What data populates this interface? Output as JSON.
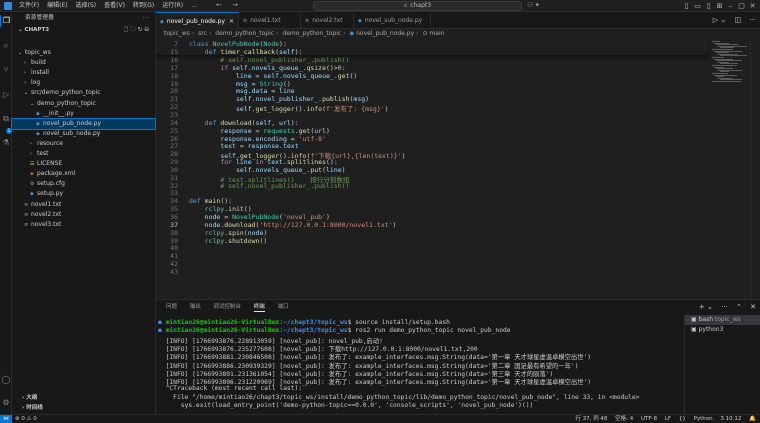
{
  "titlebar": {
    "menus": [
      "文件(F)",
      "编辑(E)",
      "选择(S)",
      "查看(V)",
      "转到(G)",
      "运行(R)",
      "…"
    ],
    "search_text": "chapt3",
    "back_glyph": "←",
    "forward_glyph": "→"
  },
  "activity_bar": {
    "icons": [
      "explorer-icon",
      "search-icon",
      "source-control-icon",
      "run-debug-icon",
      "remote-explorer-icon",
      "testing-icon",
      "accounts-icon",
      "manage-icon"
    ],
    "badge": "1"
  },
  "sidebar": {
    "header": "资源管理器",
    "project": "CHAPT3",
    "tree": [
      {
        "label": "topic_ws",
        "indent": 0,
        "kind": "folder-open"
      },
      {
        "label": "build",
        "indent": 1,
        "kind": "folder"
      },
      {
        "label": "install",
        "indent": 1,
        "kind": "folder"
      },
      {
        "label": "log",
        "indent": 1,
        "kind": "folder"
      },
      {
        "label": "src/demo_python_topic",
        "indent": 1,
        "kind": "folder-open"
      },
      {
        "label": "demo_python_topic",
        "indent": 2,
        "kind": "folder-open"
      },
      {
        "label": "__init__.py",
        "indent": 3,
        "kind": "py"
      },
      {
        "label": "novel_pub_node.py",
        "indent": 3,
        "kind": "py",
        "selected": true
      },
      {
        "label": "novel_sub_node.py",
        "indent": 3,
        "kind": "py"
      },
      {
        "label": "resource",
        "indent": 2,
        "kind": "folder"
      },
      {
        "label": "test",
        "indent": 2,
        "kind": "folder"
      },
      {
        "label": "LICENSE",
        "indent": 2,
        "kind": "lic"
      },
      {
        "label": "package.xml",
        "indent": 2,
        "kind": "xml"
      },
      {
        "label": "setup.cfg",
        "indent": 2,
        "kind": "cfg"
      },
      {
        "label": "setup.py",
        "indent": 2,
        "kind": "py"
      },
      {
        "label": "novel1.txt",
        "indent": 1,
        "kind": "txt"
      },
      {
        "label": "novel2.txt",
        "indent": 1,
        "kind": "txt"
      },
      {
        "label": "novel3.txt",
        "indent": 1,
        "kind": "txt"
      }
    ],
    "outline_label": "大纲",
    "timeline_label": "时间线"
  },
  "tabs": [
    {
      "label": "novel_pub_node.py",
      "icon": "py",
      "active": true
    },
    {
      "label": "novel1.txt",
      "icon": "txt",
      "active": false
    },
    {
      "label": "novel2.txt",
      "icon": "txt",
      "active": false
    },
    {
      "label": "novel_sub_node.py",
      "icon": "py",
      "active": false
    }
  ],
  "breadcrumb": [
    "topic_ws",
    "src",
    "demo_python_topic",
    "demo_python_topic",
    "novel_pub_node.py",
    "main"
  ],
  "editor": {
    "current_line": 37,
    "sticky": [
      {
        "num": 7,
        "tokens": [
          [
            "kw",
            "class "
          ],
          [
            "cls",
            "NovelPubNode"
          ],
          [
            "",
            "("
          ],
          [
            "cls",
            "Node"
          ],
          [
            "",
            "):"
          ]
        ]
      },
      {
        "num": 15,
        "tokens": [
          [
            "",
            "    "
          ],
          [
            "kw",
            "def "
          ],
          [
            "fn",
            "timer_callback"
          ],
          [
            "",
            "("
          ],
          [
            "slf",
            "self"
          ],
          [
            "",
            "):"
          ]
        ]
      }
    ],
    "lines": [
      {
        "num": 16,
        "tokens": [
          [
            "cm",
            "        # self.novel_publisher_.publish()"
          ]
        ]
      },
      {
        "num": 17,
        "tokens": [
          [
            "",
            "        "
          ],
          [
            "kw2",
            "if "
          ],
          [
            "slf",
            "self"
          ],
          [
            "",
            "."
          ],
          [
            "var",
            "novels_queue_"
          ],
          [
            "",
            "."
          ],
          [
            "fn",
            "qsize"
          ],
          [
            "",
            "()>"
          ],
          [
            "num",
            "0"
          ],
          [
            "",
            ":"
          ]
        ]
      },
      {
        "num": 18,
        "tokens": [
          [
            "",
            "            "
          ],
          [
            "var",
            "line"
          ],
          [
            "",
            " = "
          ],
          [
            "slf",
            "self"
          ],
          [
            "",
            "."
          ],
          [
            "var",
            "novels_queue_"
          ],
          [
            "",
            "."
          ],
          [
            "fn",
            "get"
          ],
          [
            "",
            "()"
          ]
        ]
      },
      {
        "num": 19,
        "tokens": [
          [
            "",
            "            "
          ],
          [
            "var",
            "msg"
          ],
          [
            "",
            " = "
          ],
          [
            "cls",
            "String"
          ],
          [
            "",
            "()"
          ]
        ]
      },
      {
        "num": 20,
        "tokens": [
          [
            "",
            "            "
          ],
          [
            "var",
            "msg"
          ],
          [
            "",
            "."
          ],
          [
            "var",
            "data"
          ],
          [
            "",
            " = "
          ],
          [
            "var",
            "line"
          ]
        ]
      },
      {
        "num": 21,
        "tokens": [
          [
            "",
            "            "
          ],
          [
            "slf",
            "self"
          ],
          [
            "",
            "."
          ],
          [
            "var",
            "novel_publisher_"
          ],
          [
            "",
            "."
          ],
          [
            "fn",
            "publish"
          ],
          [
            "",
            "("
          ],
          [
            "var",
            "msg"
          ],
          [
            "",
            ")"
          ]
        ]
      },
      {
        "num": 22,
        "tokens": [
          [
            "",
            "            "
          ],
          [
            "slf",
            "self"
          ],
          [
            "",
            "."
          ],
          [
            "fn",
            "get_logger"
          ],
          [
            "",
            "()."
          ],
          [
            "fn",
            "info"
          ],
          [
            "",
            "("
          ],
          [
            "str",
            "f'发布了: {msg}'"
          ],
          [
            "",
            ")"
          ]
        ]
      },
      {
        "num": 23,
        "tokens": []
      },
      {
        "num": 24,
        "tokens": [
          [
            "",
            "    "
          ],
          [
            "kw",
            "def "
          ],
          [
            "fn",
            "download"
          ],
          [
            "",
            "("
          ],
          [
            "slf",
            "self"
          ],
          [
            "",
            ", "
          ],
          [
            "var",
            "url"
          ],
          [
            "",
            "):"
          ]
        ]
      },
      {
        "num": 25,
        "tokens": [
          [
            "",
            "        "
          ],
          [
            "var",
            "response"
          ],
          [
            "",
            " = "
          ],
          [
            "cls",
            "requests"
          ],
          [
            "",
            "."
          ],
          [
            "fn",
            "get"
          ],
          [
            "",
            "("
          ],
          [
            "var",
            "url"
          ],
          [
            "",
            ")"
          ]
        ]
      },
      {
        "num": 26,
        "tokens": [
          [
            "",
            "        "
          ],
          [
            "var",
            "response"
          ],
          [
            "",
            "."
          ],
          [
            "var",
            "encoding"
          ],
          [
            "",
            " = "
          ],
          [
            "str",
            "'utf-8'"
          ]
        ]
      },
      {
        "num": 27,
        "tokens": [
          [
            "",
            "        "
          ],
          [
            "var",
            "text"
          ],
          [
            "",
            " = "
          ],
          [
            "var",
            "response"
          ],
          [
            "",
            "."
          ],
          [
            "var",
            "text"
          ]
        ]
      },
      {
        "num": 28,
        "tokens": [
          [
            "",
            "        "
          ],
          [
            "slf",
            "self"
          ],
          [
            "",
            "."
          ],
          [
            "fn",
            "get_logger"
          ],
          [
            "",
            "()."
          ],
          [
            "fn",
            "info"
          ],
          [
            "",
            "("
          ],
          [
            "str",
            "f'下载{url},{len(text)}'"
          ],
          [
            "",
            ")"
          ]
        ]
      },
      {
        "num": 29,
        "tokens": [
          [
            "",
            "        "
          ],
          [
            "kw2",
            "for "
          ],
          [
            "var",
            "line"
          ],
          [
            "kw2",
            " in "
          ],
          [
            "var",
            "text"
          ],
          [
            "",
            "."
          ],
          [
            "fn",
            "splitlines"
          ],
          [
            "",
            "():"
          ]
        ]
      },
      {
        "num": 30,
        "tokens": [
          [
            "",
            "            "
          ],
          [
            "slf",
            "self"
          ],
          [
            "",
            "."
          ],
          [
            "var",
            "novels_queue_"
          ],
          [
            "",
            "."
          ],
          [
            "fn",
            "put"
          ],
          [
            "",
            "("
          ],
          [
            "var",
            "line"
          ],
          [
            "",
            ")"
          ]
        ]
      },
      {
        "num": 31,
        "tokens": [
          [
            "cm",
            "        # text.splitlines()    按行分割数组"
          ]
        ]
      },
      {
        "num": 32,
        "tokens": [
          [
            "cm",
            "        # self.novel_publisher_.publish()"
          ]
        ]
      },
      {
        "num": 33,
        "tokens": []
      },
      {
        "num": 34,
        "tokens": [
          [
            "kw",
            "def "
          ],
          [
            "fn",
            "main"
          ],
          [
            "",
            "():"
          ]
        ]
      },
      {
        "num": 35,
        "tokens": [
          [
            "",
            "    "
          ],
          [
            "cls",
            "rclpy"
          ],
          [
            "",
            "."
          ],
          [
            "fn",
            "init"
          ],
          [
            "",
            "()"
          ]
        ]
      },
      {
        "num": 36,
        "tokens": [
          [
            "",
            "    "
          ],
          [
            "var",
            "node"
          ],
          [
            "",
            " = "
          ],
          [
            "cls",
            "NovelPubNode"
          ],
          [
            "",
            "("
          ],
          [
            "str",
            "'novel_pub'"
          ],
          [
            "",
            ")"
          ]
        ]
      },
      {
        "num": 37,
        "tokens": [
          [
            "",
            "    "
          ],
          [
            "var",
            "node"
          ],
          [
            "",
            "."
          ],
          [
            "fn",
            "download"
          ],
          [
            "",
            "("
          ],
          [
            "str",
            "'http://127.0.0.1:8000/novel1.txt'"
          ],
          [
            "",
            ")"
          ]
        ]
      },
      {
        "num": 38,
        "tokens": [
          [
            "",
            "    "
          ],
          [
            "cls",
            "rclpy"
          ],
          [
            "",
            "."
          ],
          [
            "fn",
            "spin"
          ],
          [
            "",
            "("
          ],
          [
            "var",
            "node"
          ],
          [
            "",
            ")"
          ]
        ]
      },
      {
        "num": 39,
        "tokens": [
          [
            "",
            "    "
          ],
          [
            "cls",
            "rclpy"
          ],
          [
            "",
            "."
          ],
          [
            "fn",
            "shutdown"
          ],
          [
            "",
            "()"
          ]
        ]
      },
      {
        "num": 40,
        "tokens": []
      },
      {
        "num": 41,
        "tokens": []
      },
      {
        "num": 42,
        "tokens": []
      },
      {
        "num": 43,
        "tokens": []
      }
    ]
  },
  "panel": {
    "tabs": [
      "问题",
      "输出",
      "调试控制台",
      "终端",
      "端口"
    ],
    "active_tab": "终端",
    "terminal_lines": [
      {
        "type": "prompt",
        "user": "mintiao26@mintiao26-VirtualBox",
        "path": "~/chapt3/topic_ws",
        "cmd": "source install/setup.bash"
      },
      {
        "type": "prompt",
        "user": "mintiao26@mintiao26-VirtualBox",
        "path": "~/chapt3/topic_ws",
        "cmd": "ros2 run demo_python_topic novel_pub_node"
      },
      {
        "type": "text",
        "text": "[INFO] [1766993876.228913059] [novel_pub]: novel_pub,启动!"
      },
      {
        "type": "text",
        "text": "[INFO] [1766993876.235277608] [novel_pub]: 下载http://127.0.0.1:8000/novel1.txt,200"
      },
      {
        "type": "text",
        "text": "[INFO] [1766993881.230846508] [novel_pub]: 发布了: example_interfaces.msg.String(data='第一章 天才球星虚温卓横空出世')"
      },
      {
        "type": "text",
        "text": "[INFO] [1766993886.230939329] [novel_pub]: 发布了: example_interfaces.msg.String(data='第二章 国足最有希望的一年')"
      },
      {
        "type": "text",
        "text": "[INFO] [1766993891.231361054] [novel_pub]: 发布了: example_interfaces.msg.String(data='第三章 天才的陨落')"
      },
      {
        "type": "text",
        "text": "[INFO] [1766993896.231220969] [novel_pub]: 发布了: example_interfaces.msg.String(data='第一章 天才球星虚温卓横空出世')"
      },
      {
        "type": "text",
        "text": "^CTraceback (most recent call last):"
      },
      {
        "type": "text",
        "text": "  File \"/home/mintiao26/chapt3/topic_ws/install/demo_python_topic/lib/demo_python_topic/novel_pub_node\", line 33, in <module>"
      },
      {
        "type": "text",
        "text": "    sys.exit(load_entry_point('demo-python-topic==0.0.0', 'console_scripts', 'novel_pub_node')())"
      }
    ],
    "terminals": [
      {
        "name": "bash",
        "sub": "topic_ws",
        "active": true
      },
      {
        "name": "python3",
        "sub": "",
        "active": false
      }
    ]
  },
  "statusbar": {
    "errors": "0",
    "warnings": "0",
    "position": "行 37, 列 48",
    "spaces": "空格: 4",
    "encoding": "UTF-8",
    "eol": "LF",
    "language": "Python",
    "version": "3.10.12"
  }
}
